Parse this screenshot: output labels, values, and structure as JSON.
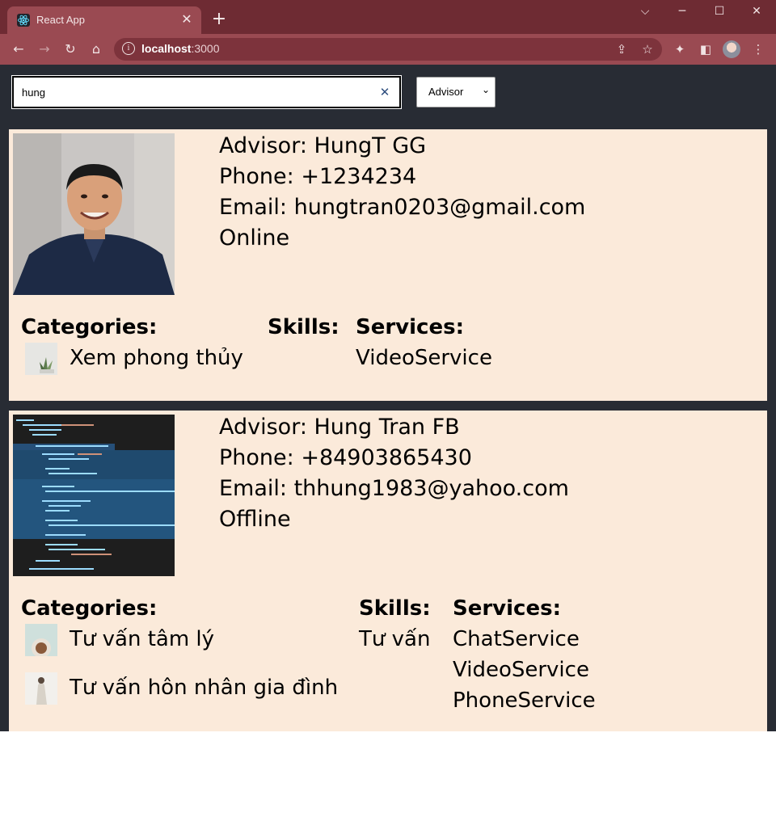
{
  "browser": {
    "tab_title": "React App",
    "url_host": "localhost",
    "url_port": ":3000"
  },
  "search": {
    "value": "hung",
    "role_selected": "Advisor"
  },
  "advisors": [
    {
      "line_name": "Advisor: HungT GG",
      "line_phone": "Phone: +1234234",
      "line_email": "Email: hungtran0203@gmail.com",
      "status": "Online",
      "categories": [
        "Xem phong thủy"
      ],
      "skills": [],
      "services": [
        "VideoService"
      ]
    },
    {
      "line_name": "Advisor: Hung Tran FB",
      "line_phone": "Phone: +84903865430",
      "line_email": "Email: thhung1983@yahoo.com",
      "status": "Offline",
      "categories": [
        "Tư vấn tâm lý",
        "Tư vấn hôn nhân gia đình"
      ],
      "skills": [
        "Tư vấn"
      ],
      "services": [
        "ChatService",
        "VideoService",
        "PhoneService"
      ]
    }
  ],
  "labels": {
    "categories": "Categories:",
    "skills": "Skills:",
    "services": "Services:"
  }
}
